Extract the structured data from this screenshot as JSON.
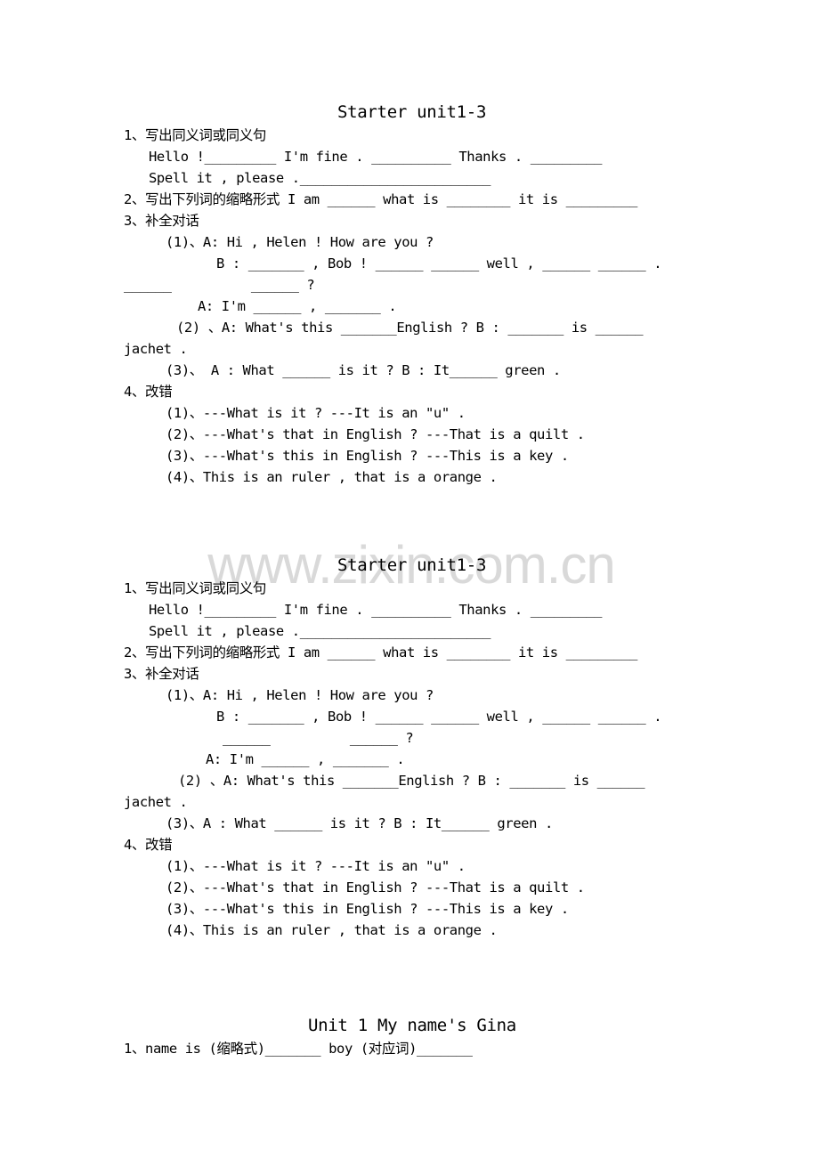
{
  "watermark": "www.zixin.com.cn",
  "sections": [
    {
      "title": "Starter unit1-3",
      "lines": [
        "1、写出同义词或同义句",
        "Hello !_________ I'm fine . __________ Thanks . _________",
        "Spell it , please .________________________",
        "2、写出下列词的缩略形式 I am ______ what is ________ it is _________",
        "3、补全对话",
        "(1)、A: Hi , Helen ! How are you ?",
        "B : _______ , Bob ! ______ ______ well , ______ ______ .",
        "______          ______ ?",
        "A: I'm ______ , _______ .",
        "(2) 、A: What's this _______English ? B : _______ is ______",
        "jachet .",
        "(3)、 A : What ______ is it ? B : It______ green .",
        "4、改错",
        "(1)、---What is it ? ---It is an \"u\" .",
        "(2)、---What's that in English ? ---That is a quilt .",
        "(3)、---What's this in English ? ---This is a key .",
        "(4)、This is an ruler , that is a orange ."
      ]
    },
    {
      "title": "Starter unit1-3",
      "lines": [
        "1、写出同义词或同义句",
        "Hello !_________ I'm fine . __________ Thanks . _________",
        "Spell it , please .________________________",
        "2、写出下列词的缩略形式 I am ______ what is ________ it is _________",
        "3、补全对话",
        "(1)、A: Hi , Helen ! How are you ?",
        "B : _______ , Bob ! ______ ______ well , ______ ______ .",
        "______          ______ ?",
        "A: I'm ______ , _______ .",
        "(2) 、A: What's this _______English ? B : _______ is ______",
        "jachet .",
        "(3)、A : What ______ is it ? B : It______ green .",
        "4、改错",
        "(1)、---What is it ? ---It is an \"u\" .",
        "(2)、---What's that in English ? ---That is a quilt .",
        "(3)、---What's this in English ? ---This is a key .",
        "(4)、This is an ruler , that is a orange ."
      ]
    },
    {
      "title": "Unit 1 My name's Gina",
      "lines": [
        "1、name is (缩略式)_______ boy (对应词)_______"
      ]
    }
  ]
}
